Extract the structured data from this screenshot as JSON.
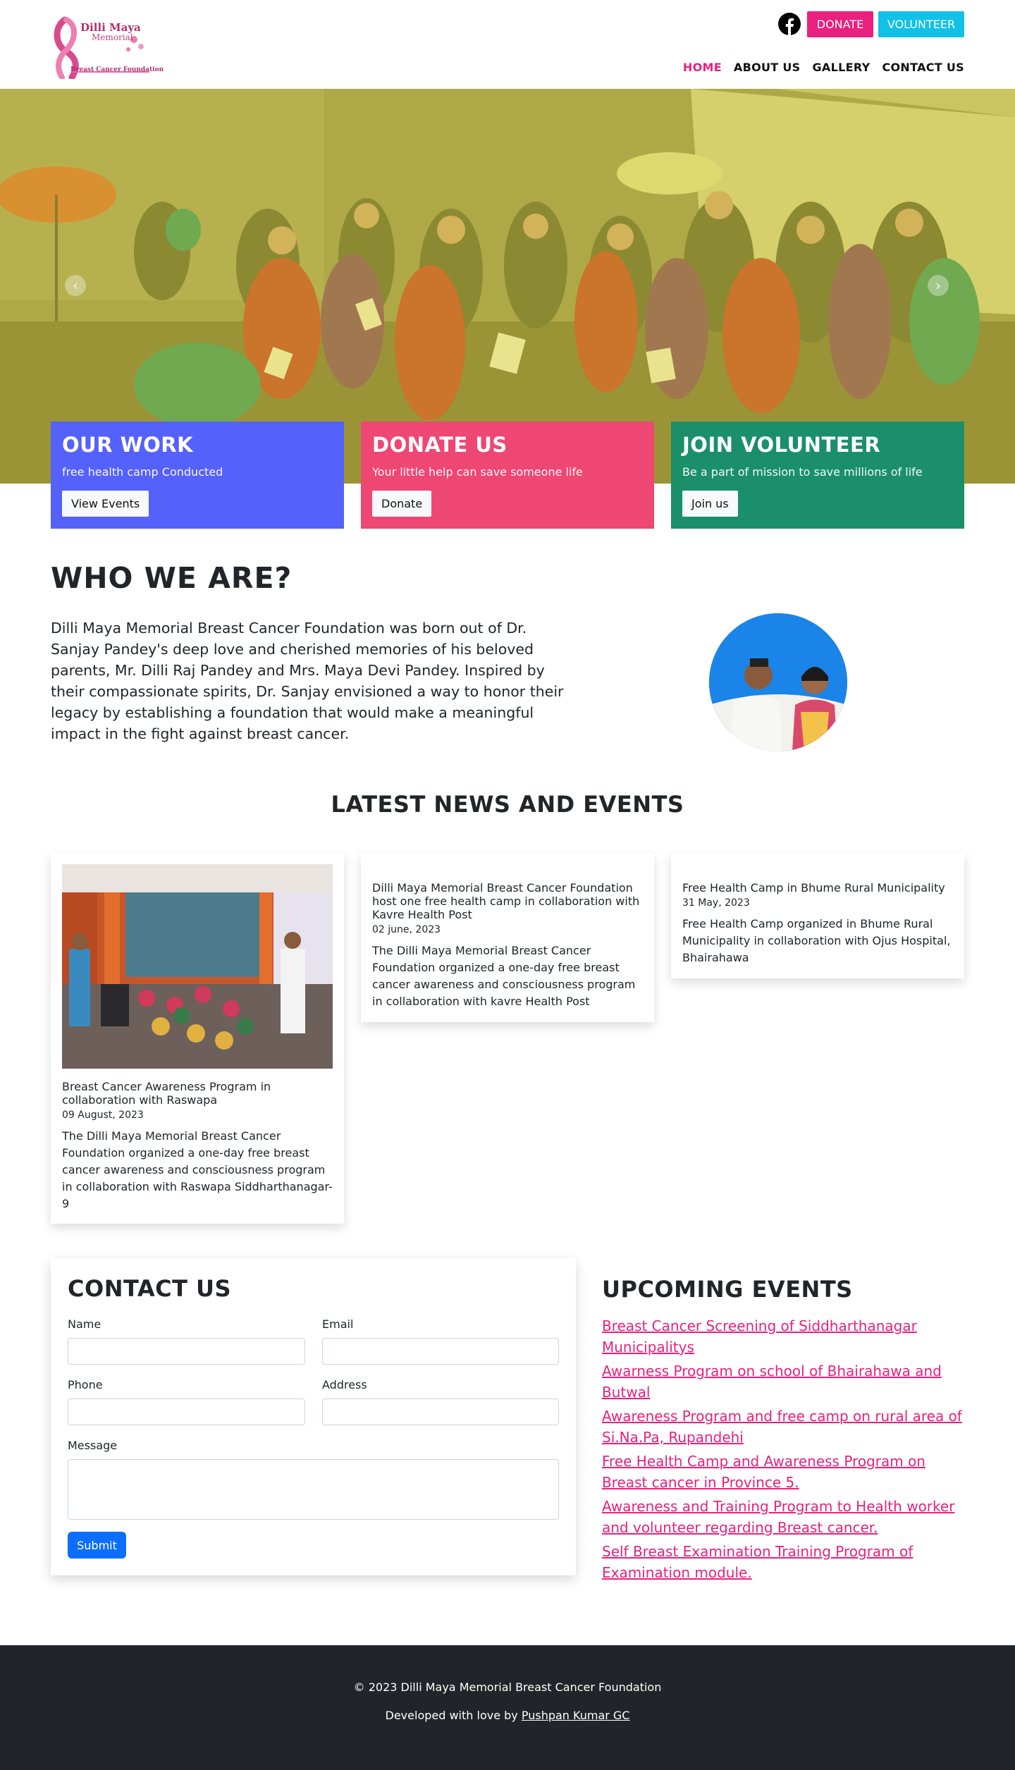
{
  "logo": {
    "line1": "Dilli Maya",
    "line2": "Memorial",
    "line3": "Breast Cancer Foundation"
  },
  "header": {
    "donate_label": "DONATE",
    "volunteer_label": "VOLUNTEER",
    "nav": [
      "HOME",
      "ABOUT US",
      "GALLERY",
      "CONTACT US"
    ],
    "active_nav": "HOME",
    "accent": "#e9207d",
    "volunteer_color": "#11c1e8"
  },
  "hero_cards": [
    {
      "title": "OUR WORK",
      "text": "free health camp Conducted",
      "button": "View Events",
      "color": "#5561fb"
    },
    {
      "title": "DONATE US",
      "text": "Your little help can save someone life",
      "button": "Donate",
      "color": "#ee4773"
    },
    {
      "title": "JOIN VOLUNTEER",
      "text": "Be a part of mission to save millions of life",
      "button": "Join us",
      "color": "#1a8f6a"
    }
  ],
  "who": {
    "title": "WHO WE ARE?",
    "text": "Dilli Maya Memorial Breast Cancer Foundation was born out of Dr. Sanjay Pandey's deep love and cherished memories of his beloved parents, Mr. Dilli Raj Pandey and Mrs. Maya Devi Pandey. Inspired by their compassionate spirits, Dr. Sanjay envisioned a way to honor their legacy by establishing a foundation that would make a meaningful impact in the fight against breast cancer."
  },
  "news": {
    "title": "LATEST NEWS AND EVENTS",
    "items": [
      {
        "title": "Breast Cancer Awareness Program in collaboration with Raswapa",
        "date": "09 August, 2023",
        "body": "The Dilli Maya Memorial Breast Cancer Foundation organized a one-day free breast cancer awareness and consciousness program in collaboration with Raswapa Siddharthanagar-9"
      },
      {
        "title": "Dilli Maya Memorial Breast Cancer Foundation host one free health camp in collaboration with Kavre Health Post",
        "date": "02 june, 2023",
        "body": "The Dilli Maya Memorial Breast Cancer Foundation organized a one-day free breast cancer awareness and consciousness program in collaboration with kavre Health Post"
      },
      {
        "title": "Free Health Camp in Bhume Rural Municipality",
        "date": "31 May, 2023",
        "body": "Free Health Camp organized in Bhume Rural Municipality in collaboration with Ojus Hospital, Bhairahawa"
      }
    ]
  },
  "contact": {
    "title": "CONTACT US",
    "name_label": "Name",
    "email_label": "Email",
    "phone_label": "Phone",
    "address_label": "Address",
    "message_label": "Message",
    "submit_label": "Submit"
  },
  "events": {
    "title": "UPCOMING EVENTS",
    "items": [
      "Breast Cancer Screening of Siddharthanagar Municipalitys",
      "Awarness Program on school of Bhairahawa and Butwal",
      "Awareness Program and free camp on rural area of Si.Na.Pa, Rupandehi",
      "Free Health Camp and Awareness Program on Breast cancer in Province 5.",
      "Awareness and Training Program to Health worker and volunteer regarding Breast cancer.",
      "Self Breast Examination Training Program of Examination module."
    ]
  },
  "footer": {
    "copyright": "© 2023 Dilli Maya Memorial Breast Cancer Foundation",
    "dev_prefix": "Developed with love by ",
    "dev_name": "Pushpan Kumar GC"
  }
}
